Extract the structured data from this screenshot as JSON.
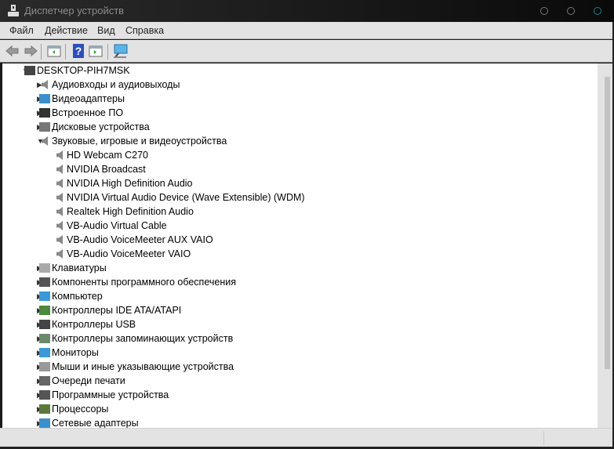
{
  "window": {
    "title": "Диспетчер устройств"
  },
  "menu": [
    "Файл",
    "Действие",
    "Вид",
    "Справка"
  ],
  "toolbar": [
    "back-icon",
    "forward-icon",
    "properties-icon",
    "help-icon",
    "update-driver-icon",
    "scan-hardware-icon"
  ],
  "tree": {
    "root": "DESKTOP-PIH7MSK",
    "categories": [
      {
        "label": "Аудиовходы и аудиовыходы",
        "icon": "speaker-icon",
        "expanded": false
      },
      {
        "label": "Видеоадаптеры",
        "icon": "display-adapter-icon",
        "expanded": false
      },
      {
        "label": "Встроенное ПО",
        "icon": "firmware-icon",
        "expanded": false
      },
      {
        "label": "Дисковые устройства",
        "icon": "disk-icon",
        "expanded": false
      },
      {
        "label": "Звуковые, игровые и видеоустройства",
        "icon": "speaker-icon",
        "expanded": true,
        "children": [
          "HD Webcam C270",
          "NVIDIA Broadcast",
          "NVIDIA High Definition Audio",
          "NVIDIA Virtual Audio Device (Wave Extensible) (WDM)",
          "Realtek High Definition Audio",
          "VB-Audio Virtual Cable",
          "VB-Audio VoiceMeeter AUX VAIO",
          "VB-Audio VoiceMeeter VAIO"
        ]
      },
      {
        "label": "Клавиатуры",
        "icon": "keyboard-icon",
        "expanded": false
      },
      {
        "label": "Компоненты программного обеспечения",
        "icon": "software-component-icon",
        "expanded": false
      },
      {
        "label": "Компьютер",
        "icon": "computer-icon",
        "expanded": false
      },
      {
        "label": "Контроллеры IDE ATA/ATAPI",
        "icon": "ide-controller-icon",
        "expanded": false
      },
      {
        "label": "Контроллеры USB",
        "icon": "usb-icon",
        "expanded": false
      },
      {
        "label": "Контроллеры запоминающих устройств",
        "icon": "storage-controller-icon",
        "expanded": false
      },
      {
        "label": "Мониторы",
        "icon": "monitor-icon",
        "expanded": false
      },
      {
        "label": "Мыши и иные указывающие устройства",
        "icon": "mouse-icon",
        "expanded": false
      },
      {
        "label": "Очереди печати",
        "icon": "printer-icon",
        "expanded": false
      },
      {
        "label": "Программные устройства",
        "icon": "software-device-icon",
        "expanded": false
      },
      {
        "label": "Процессоры",
        "icon": "processor-icon",
        "expanded": false
      },
      {
        "label": "Сетевые адаптеры",
        "icon": "network-adapter-icon",
        "expanded": false
      }
    ]
  },
  "colors": {
    "titlebar": "#0a0a0a",
    "chrome": "#e3e3e3",
    "accent": "#1ba1e2"
  }
}
